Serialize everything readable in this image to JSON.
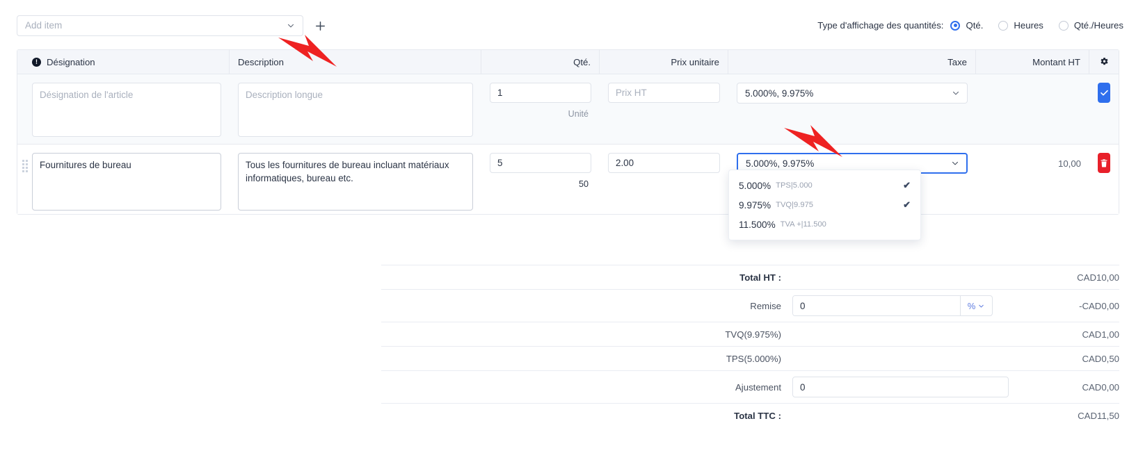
{
  "toolbar": {
    "add_item_placeholder": "Add item",
    "add_button_label": "+",
    "quantity_display": {
      "label": "Type d'affichage des quantités:",
      "options": [
        {
          "label": "Qté.",
          "selected": true
        },
        {
          "label": "Heures",
          "selected": false
        },
        {
          "label": "Qté./Heures",
          "selected": false
        }
      ]
    }
  },
  "table": {
    "headers": {
      "designation": "Désignation",
      "description": "Description",
      "qty": "Qté.",
      "unit_price": "Prix unitaire",
      "tax": "Taxe",
      "amount_ht": "Montant HT",
      "settings_icon": "gear-icon"
    },
    "entry_row": {
      "designation_placeholder": "Désignation de l'article",
      "designation_value": "",
      "description_placeholder": "Description longue",
      "description_value": "",
      "qty_value": "1",
      "qty_sub": "Unité",
      "price_placeholder": "Prix HT",
      "price_value": "",
      "tax_value": "5.000%, 9.975%",
      "confirm_icon": "check-icon"
    },
    "item_row": {
      "designation_value": "Fournitures de bureau",
      "description_value": "Tous les fournitures de bureau incluant matériaux informatiques, bureau etc.",
      "qty_value": "5",
      "qty_sub": "50",
      "price_value": "2.00",
      "tax_value": "5.000%, 9.975%",
      "amount": "10,00",
      "delete_icon": "trash-icon",
      "drag_handle_icon": "drag-handle-icon"
    }
  },
  "tax_dropdown": {
    "open": true,
    "options": [
      {
        "percent": "5.000%",
        "code": "TPS|5.000",
        "checked": true
      },
      {
        "percent": "9.975%",
        "code": "TVQ|9.975",
        "checked": true
      },
      {
        "percent": "11.500%",
        "code": "TVA +|11.500",
        "checked": false
      }
    ]
  },
  "totals": {
    "total_ht_label": "Total HT :",
    "total_ht_value": "CAD10,00",
    "remise_label": "Remise",
    "remise_value": "0",
    "remise_unit": "%",
    "remise_total": "-CAD0,00",
    "tvq_label": "TVQ(9.975%)",
    "tvq_value": "CAD1,00",
    "tps_label": "TPS(5.000%)",
    "tps_value": "CAD0,50",
    "ajustement_label": "Ajustement",
    "ajustement_value": "0",
    "ajustement_total": "CAD0,00",
    "total_ttc_label": "Total TTC :",
    "total_ttc_value": "CAD11,50"
  },
  "annotations": {
    "arrow_1": "red-arrow-pointing-to-add-item",
    "arrow_2": "red-arrow-pointing-to-tax-select"
  },
  "colors": {
    "accent": "#2f6fed",
    "danger": "#e8202a",
    "header_bg": "#f4f6fa",
    "border": "#e6e9ef",
    "muted_text": "#8d95a3"
  }
}
